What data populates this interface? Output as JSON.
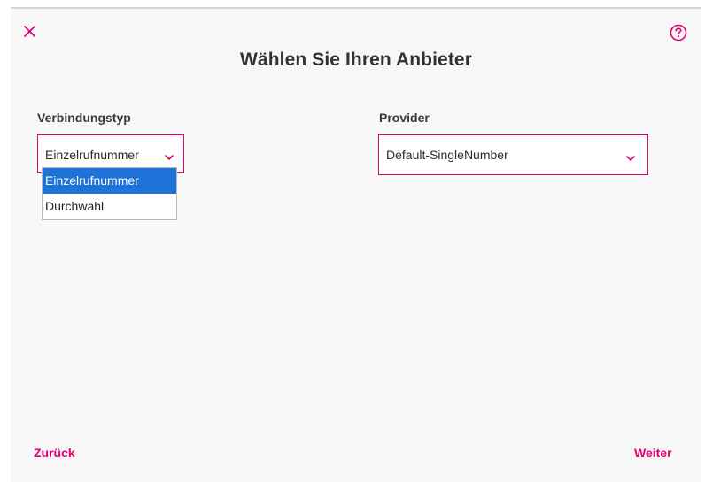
{
  "dialog": {
    "title": "Wählen Sie Ihren Anbieter",
    "close_icon": "close-icon",
    "help_icon": "help-circle-icon",
    "accent_color": "#e20074"
  },
  "connection_type": {
    "label": "Verbindungstyp",
    "selected_value": "Einzelrufnummer",
    "options": [
      "Einzelrufnummer",
      "Durchwahl"
    ],
    "highlighted_option": "Einzelrufnummer",
    "dropdown_open": true
  },
  "provider": {
    "label": "Provider",
    "selected_value": "Default-SingleNumber"
  },
  "footer": {
    "back_label": "Zurück",
    "next_label": "Weiter"
  }
}
